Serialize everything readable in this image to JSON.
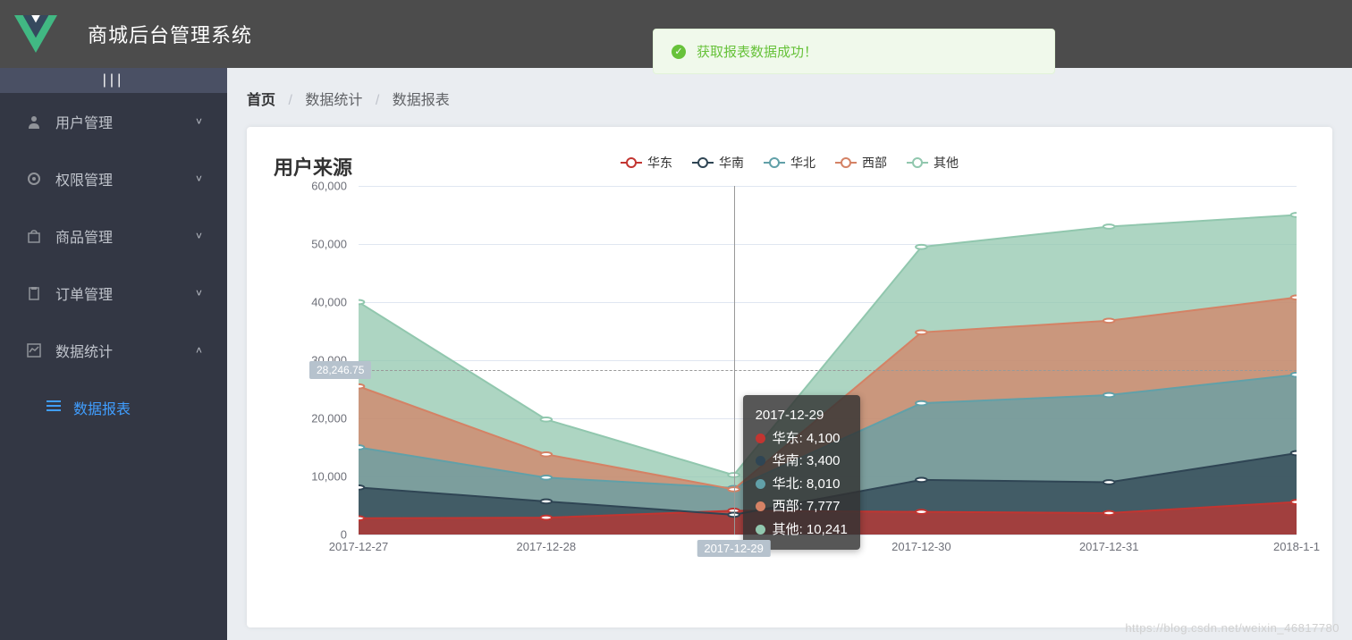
{
  "header": {
    "title": "商城后台管理系统"
  },
  "toast": {
    "text": "获取报表数据成功！"
  },
  "sidebar": {
    "collapse_glyph": "|||",
    "items": [
      {
        "label": "用户管理",
        "icon": "user"
      },
      {
        "label": "权限管理",
        "icon": "gear"
      },
      {
        "label": "商品管理",
        "icon": "bag"
      },
      {
        "label": "订单管理",
        "icon": "clipboard"
      },
      {
        "label": "数据统计",
        "icon": "chart",
        "expanded": true
      }
    ],
    "sub": {
      "label": "数据报表"
    }
  },
  "breadcrumb": {
    "home": "首页",
    "a": "数据统计",
    "b": "数据报表"
  },
  "chart_data": {
    "type": "area",
    "title": "用户来源",
    "xlabel": "",
    "ylabel": "",
    "ylim": [
      0,
      60000
    ],
    "yticks": [
      0,
      10000,
      20000,
      30000,
      40000,
      50000,
      60000
    ],
    "ytick_labels": [
      "0",
      "10,000",
      "20,000",
      "30,000",
      "40,000",
      "50,000",
      "60,000"
    ],
    "categories": [
      "2017-12-27",
      "2017-12-28",
      "2017-12-29",
      "2017-12-30",
      "2017-12-31",
      "2018-1-1"
    ],
    "series": [
      {
        "name": "华东",
        "color": "#c23531",
        "values": [
          2800,
          2900,
          4100,
          3900,
          3700,
          5600
        ]
      },
      {
        "name": "华南",
        "color": "#2f4554",
        "values": [
          8100,
          5700,
          3400,
          9400,
          9000,
          14000
        ]
      },
      {
        "name": "华北",
        "color": "#61a0a8",
        "values": [
          15000,
          9800,
          8010,
          22600,
          24000,
          27500
        ]
      },
      {
        "name": "西部",
        "color": "#d48265",
        "values": [
          25500,
          13800,
          7777,
          34800,
          36800,
          40800
        ]
      },
      {
        "name": "其他",
        "color": "#91c7ae",
        "values": [
          40000,
          19800,
          10241,
          49500,
          53000,
          55000
        ]
      }
    ],
    "crosshair": {
      "index": 2,
      "y_value": 28246.75,
      "y_label": "28,246.75"
    },
    "tooltip": {
      "title": "2017-12-29",
      "rows": [
        {
          "name": "华东",
          "val": "4,100",
          "color": "#c23531"
        },
        {
          "name": "华南",
          "val": "3,400",
          "color": "#2f4554"
        },
        {
          "name": "华北",
          "val": "8,010",
          "color": "#61a0a8"
        },
        {
          "name": "西部",
          "val": "7,777",
          "color": "#d48265"
        },
        {
          "name": "其他",
          "val": "10,241",
          "color": "#91c7ae"
        }
      ]
    }
  },
  "watermark": "https://blog.csdn.net/weixin_46817780"
}
